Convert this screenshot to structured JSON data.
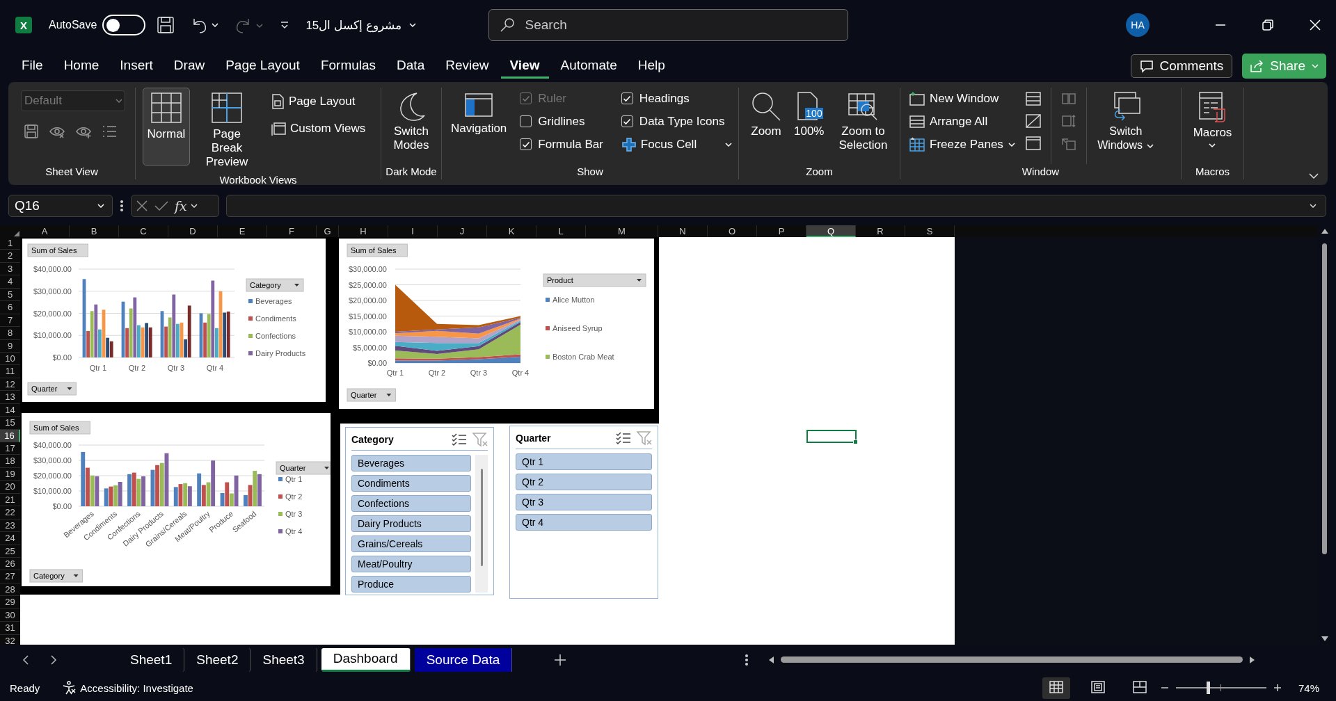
{
  "title_bar": {
    "logo": "X",
    "autosave_label": "AutoSave",
    "autosave_on": false,
    "file_name": "مشروع إكسل ال15",
    "search": {
      "placeholder": "Search"
    },
    "avatar": "HA"
  },
  "menu": {
    "tabs": [
      {
        "label": "File",
        "selected": false
      },
      {
        "label": "Home",
        "selected": false
      },
      {
        "label": "Insert",
        "selected": false
      },
      {
        "label": "Draw",
        "selected": false
      },
      {
        "label": "Page Layout",
        "selected": false
      },
      {
        "label": "Formulas",
        "selected": false
      },
      {
        "label": "Data",
        "selected": false
      },
      {
        "label": "Review",
        "selected": false
      },
      {
        "label": "View",
        "selected": true
      },
      {
        "label": "Automate",
        "selected": false
      },
      {
        "label": "Help",
        "selected": false
      }
    ],
    "comments": "Comments",
    "share": "Share"
  },
  "ribbon": {
    "sheet_view": {
      "label": "Sheet View",
      "dropdown": "Default",
      "dropdown_disabled": true
    },
    "workbook_views": {
      "label": "Workbook Views",
      "buttons": [
        {
          "label": "Normal",
          "selected": true
        },
        {
          "label": "Page Break Preview",
          "selected": false
        }
      ],
      "small_buttons": [
        "Page Layout",
        "Custom Views"
      ]
    },
    "dark_mode": {
      "label": "Dark Mode",
      "button": "Switch Modes"
    },
    "show": {
      "label": "Show",
      "navigation": "Navigation",
      "checkboxes": [
        {
          "label": "Ruler",
          "checked": true,
          "disabled": true
        },
        {
          "label": "Gridlines",
          "checked": false,
          "disabled": false
        },
        {
          "label": "Formula Bar",
          "checked": true,
          "disabled": false
        },
        {
          "label": "Headings",
          "checked": true,
          "disabled": false
        },
        {
          "label": "Data Type Icons",
          "checked": true,
          "disabled": false
        }
      ],
      "focus_cell": "Focus Cell"
    },
    "zoom": {
      "label": "Zoom",
      "buttons": [
        "Zoom",
        "100%",
        "Zoom to Selection"
      ],
      "badge": "100"
    },
    "window": {
      "label": "Window",
      "buttons": [
        "New Window",
        "Arrange All",
        "Freeze Panes"
      ],
      "switch_windows": "Switch Windows"
    },
    "macros": {
      "label": "Macros",
      "button": "Macros"
    }
  },
  "formula_bar": {
    "name_box": "Q16",
    "function_button": "fx"
  },
  "sheet": {
    "columns": [
      {
        "label": "A",
        "selected": false
      },
      {
        "label": "B",
        "selected": false
      },
      {
        "label": "C",
        "selected": false
      },
      {
        "label": "D",
        "selected": false
      },
      {
        "label": "E",
        "selected": false
      },
      {
        "label": "F",
        "selected": false
      },
      {
        "label": "G",
        "selected": false
      },
      {
        "label": "H",
        "selected": false
      },
      {
        "label": "I",
        "selected": false
      },
      {
        "label": "J",
        "selected": false
      },
      {
        "label": "K",
        "selected": false
      },
      {
        "label": "L",
        "selected": false
      },
      {
        "label": "M",
        "selected": false
      },
      {
        "label": "N",
        "selected": false
      },
      {
        "label": "O",
        "selected": false
      },
      {
        "label": "P",
        "selected": false
      },
      {
        "label": "Q",
        "selected": true
      },
      {
        "label": "R",
        "selected": false
      },
      {
        "label": "S",
        "selected": false
      }
    ],
    "rows": [
      {
        "label": "1",
        "selected": false
      },
      {
        "label": "2",
        "selected": false
      },
      {
        "label": "3",
        "selected": false
      },
      {
        "label": "4",
        "selected": false
      },
      {
        "label": "5",
        "selected": false
      },
      {
        "label": "6",
        "selected": false
      },
      {
        "label": "7",
        "selected": false
      },
      {
        "label": "8",
        "selected": false
      },
      {
        "label": "9",
        "selected": false
      },
      {
        "label": "10",
        "selected": false
      },
      {
        "label": "11",
        "selected": false
      },
      {
        "label": "12",
        "selected": false
      },
      {
        "label": "13",
        "selected": false
      },
      {
        "label": "14",
        "selected": false
      },
      {
        "label": "15",
        "selected": false
      },
      {
        "label": "16",
        "selected": true
      },
      {
        "label": "17",
        "selected": false
      },
      {
        "label": "18",
        "selected": false
      },
      {
        "label": "19",
        "selected": false
      },
      {
        "label": "20",
        "selected": false
      },
      {
        "label": "21",
        "selected": false
      },
      {
        "label": "22",
        "selected": false
      },
      {
        "label": "23",
        "selected": false
      },
      {
        "label": "24",
        "selected": false
      },
      {
        "label": "25",
        "selected": false
      },
      {
        "label": "26",
        "selected": false
      },
      {
        "label": "27",
        "selected": false
      },
      {
        "label": "28",
        "selected": false
      },
      {
        "label": "29",
        "selected": false
      },
      {
        "label": "30",
        "selected": false
      },
      {
        "label": "31",
        "selected": false
      },
      {
        "label": "32",
        "selected": false
      }
    ]
  },
  "charts": [
    {
      "value_button": "Sum of Sales",
      "axis_button": "Quarter",
      "legend_button": "Category",
      "chart_data": {
        "type": "bar",
        "grid": true,
        "legend": true,
        "categories": [
          "Qtr 1",
          "Qtr 2",
          "Qtr 3",
          "Qtr 4"
        ],
        "ylim": [
          0,
          40000
        ],
        "yticks": [
          {
            "value": 0,
            "label": "$0.00"
          },
          {
            "value": 10000,
            "label": "$10,000.00"
          },
          {
            "value": 20000,
            "label": "$20,000.00"
          },
          {
            "value": 30000,
            "label": "$30,000.00"
          },
          {
            "value": 40000,
            "label": "$40,000.00"
          }
        ],
        "series": [
          {
            "name": "Beverages",
            "color": "#4f81bd",
            "values": [
              35500,
              25300,
              21000,
              20000
            ]
          },
          {
            "name": "Condiments",
            "color": "#c0504d",
            "values": [
              12000,
              13300,
              14000,
              15800
            ]
          },
          {
            "name": "Confections",
            "color": "#9bbb59",
            "values": [
              21000,
              22200,
              18100,
              19700
            ]
          },
          {
            "name": "Dairy Products",
            "color": "#8064a2",
            "values": [
              24000,
              27200,
              28500,
              34800
            ]
          },
          {
            "color": "#4bacc6",
            "values": [
              12700,
              14600,
              15200,
              13300
            ]
          },
          {
            "color": "#f79646",
            "values": [
              21600,
              13600,
              15800,
              30000
            ]
          },
          {
            "color": "#2c4d75",
            "values": [
              8900,
              15600,
              8200,
              20300
            ]
          },
          {
            "color": "#772c2a",
            "values": [
              7300,
              13600,
              23500,
              20800
            ]
          }
        ]
      }
    },
    {
      "value_button": "Sum of Sales",
      "axis_button": "Quarter",
      "legend_button": "Product",
      "chart_data": {
        "type": "area",
        "stacked": true,
        "grid": true,
        "legend": true,
        "categories": [
          "Qtr 1",
          "Qtr 2",
          "Qtr 3",
          "Qtr 4"
        ],
        "ylim": [
          0,
          30000
        ],
        "yticks": [
          {
            "value": 0,
            "label": "$0.00"
          },
          {
            "value": 5000,
            "label": "$5,000.00"
          },
          {
            "value": 10000,
            "label": "$10,000.00"
          },
          {
            "value": 15000,
            "label": "$15,000.00"
          },
          {
            "value": 20000,
            "label": "$20,000.00"
          },
          {
            "value": 25000,
            "label": "$25,000.00"
          },
          {
            "value": 30000,
            "label": "$30,000.00"
          }
        ],
        "series": [
          {
            "name": "Alice Mutton",
            "color": "#4f81bd",
            "values": [
              800,
              800,
              1200,
              2000
            ]
          },
          {
            "name": "Aniseed Syrup",
            "color": "#c0504d",
            "values": [
              700,
              600,
              700,
              800
            ]
          },
          {
            "name": "Boston Crab Meat",
            "color": "#9bbb59",
            "values": [
              2500,
              1500,
              2500,
              9500
            ]
          },
          {
            "color": "#5f497a",
            "values": [
              1500,
              1000,
              1000,
              800
            ]
          },
          {
            "color": "#4bacc6",
            "values": [
              1200,
              2500,
              1000,
              400
            ]
          },
          {
            "color": "#b3a2c7",
            "values": [
              2000,
              2000,
              1500,
              400
            ]
          },
          {
            "color": "#f79646",
            "values": [
              800,
              1900,
              1500,
              300
            ]
          },
          {
            "color": "#8064a2",
            "values": [
              500,
              400,
              2000,
              300
            ]
          },
          {
            "color": "#b85a0e",
            "values": [
              15000,
              1800,
              700,
              500
            ]
          }
        ]
      }
    },
    {
      "value_button": "Sum of Sales",
      "axis_button": "Category",
      "legend_button": "Quarter",
      "chart_data": {
        "type": "bar",
        "grid": true,
        "legend": true,
        "categories": [
          "Beverages",
          "Condiments",
          "Confections",
          "Dairy Products",
          "Grains/Cereals",
          "Meat/Poultry",
          "Produce",
          "Seafood"
        ],
        "ylim": [
          0,
          40000
        ],
        "yticks": [
          {
            "value": 0,
            "label": "$0.00"
          },
          {
            "value": 10000,
            "label": "$10,000.00"
          },
          {
            "value": 20000,
            "label": "$20,000.00"
          },
          {
            "value": 30000,
            "label": "$30,000.00"
          },
          {
            "value": 40000,
            "label": "$40,000.00"
          }
        ],
        "series": [
          {
            "name": "Qtr 1",
            "color": "#4f81bd",
            "values": [
              35500,
              11700,
              21000,
              23800,
              12600,
              21500,
              8700,
              7300
            ]
          },
          {
            "name": "Qtr 2",
            "color": "#c0504d",
            "values": [
              25200,
              12900,
              22000,
              26900,
              14500,
              13900,
              15700,
              13900
            ]
          },
          {
            "name": "Qtr 3",
            "color": "#9bbb59",
            "values": [
              20100,
              13700,
              17900,
              28300,
              15100,
              15700,
              8400,
              23200
            ]
          },
          {
            "name": "Qtr 4",
            "color": "#8064a2",
            "values": [
              19600,
              15900,
              19600,
              34700,
              13100,
              29900,
              20100,
              21000
            ]
          }
        ]
      }
    }
  ],
  "slicers": [
    {
      "title": "Category",
      "scrollable": true,
      "items": [
        {
          "label": "Beverages",
          "selected": true
        },
        {
          "label": "Condiments",
          "selected": true
        },
        {
          "label": "Confections",
          "selected": true
        },
        {
          "label": "Dairy Products",
          "selected": true
        },
        {
          "label": "Grains/Cereals",
          "selected": true
        },
        {
          "label": "Meat/Poultry",
          "selected": true
        },
        {
          "label": "Produce",
          "selected": true
        }
      ]
    },
    {
      "title": "Quarter",
      "scrollable": false,
      "items": [
        {
          "label": "Qtr 1",
          "selected": true
        },
        {
          "label": "Qtr 2",
          "selected": true
        },
        {
          "label": "Qtr 3",
          "selected": true
        },
        {
          "label": "Qtr 4",
          "selected": true
        }
      ]
    }
  ],
  "sheet_tabs": [
    {
      "label": "Sheet1",
      "selected": false
    },
    {
      "label": "Sheet2",
      "selected": false
    },
    {
      "label": "Sheet3",
      "selected": false
    },
    {
      "label": "Dashboard",
      "selected": true
    },
    {
      "label": "Source Data",
      "selected": false,
      "color": "#00009c"
    }
  ],
  "status_bar": {
    "ready": "Ready",
    "accessibility": "Accessibility: Investigate",
    "views": [
      {
        "kind": "normal",
        "selected": true
      },
      {
        "kind": "page_layout",
        "selected": false
      },
      {
        "kind": "page_break",
        "selected": false
      }
    ],
    "zoom": {
      "level": 0.35,
      "reading": "74%"
    }
  }
}
